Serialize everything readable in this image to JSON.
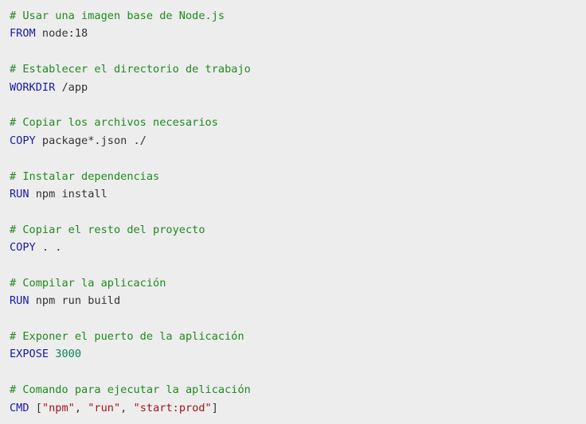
{
  "colors": {
    "background": "#ededed",
    "comment": "#1f8a1f",
    "keyword": "#1a1aa6",
    "text": "#333333",
    "number": "#098658",
    "string": "#a31515"
  },
  "code": {
    "c1": "# Usar una imagen base de Node.js",
    "l1_kw": "FROM",
    "l1_rest": " node:18",
    "c2": "# Establecer el directorio de trabajo",
    "l2_kw": "WORKDIR",
    "l2_rest": " /app",
    "c3": "# Copiar los archivos necesarios",
    "l3_kw": "COPY",
    "l3_rest": " package*.json ./",
    "c4": "# Instalar dependencias",
    "l4_kw": "RUN",
    "l4_rest": " npm install",
    "c5": "# Copiar el resto del proyecto",
    "l5_kw": "COPY",
    "l5_rest": " . .",
    "c6": "# Compilar la aplicación",
    "l6_kw": "RUN",
    "l6_rest": " npm run build",
    "c7": "# Exponer el puerto de la aplicación",
    "l7_kw": "EXPOSE",
    "l7_num": "3000",
    "c8": "# Comando para ejecutar la aplicación",
    "l8_kw": "CMD",
    "l8_open": " [",
    "l8_s1": "\"npm\"",
    "l8_sep1": ", ",
    "l8_s2": "\"run\"",
    "l8_sep2": ", ",
    "l8_s3": "\"start:prod\"",
    "l8_close": "]"
  }
}
